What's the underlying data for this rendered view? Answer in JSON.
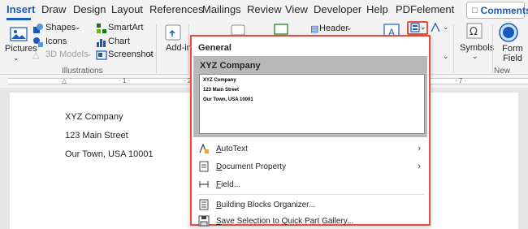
{
  "tabs": [
    "Insert",
    "Draw",
    "Design",
    "Layout",
    "References",
    "Mailings",
    "Review",
    "View",
    "Developer",
    "Help",
    "PDFelement"
  ],
  "comments_label": "Comments",
  "ribbon": {
    "pictures": "Pictures",
    "shapes": "Shapes",
    "icons": "Icons",
    "models3d": "3D Models",
    "smartart": "SmartArt",
    "chart": "Chart",
    "screenshot": "Screenshot",
    "illustrations_group": "Illustrations",
    "addins": "Add-ins",
    "header": "Header",
    "symbols": "Symbols",
    "form_field": "Form Field",
    "new_group": "New Group"
  },
  "document": {
    "lines": [
      "XYZ Company",
      "123 Main Street",
      "Our Town, USA 10001"
    ]
  },
  "quick_parts": {
    "section_heading": "General",
    "entry_title": "XYZ Company",
    "preview_lines": [
      "XYZ Company",
      "123 Main Street",
      "Our Town, USA 10001"
    ],
    "menu": [
      {
        "label": "AutoText",
        "icon": "autotext-icon",
        "submenu": true
      },
      {
        "label": "Document Property",
        "icon": "document-property-icon",
        "submenu": true
      },
      {
        "label": "Field...",
        "icon": "field-icon",
        "submenu": false
      },
      {
        "label": "Building Blocks Organizer...",
        "icon": "building-blocks-icon",
        "submenu": false
      },
      {
        "label": "Save Selection to Quick Part Gallery...",
        "icon": "save-icon",
        "submenu": false
      }
    ]
  },
  "colors": {
    "accent": "#185abd",
    "highlight": "#e74c3c"
  }
}
